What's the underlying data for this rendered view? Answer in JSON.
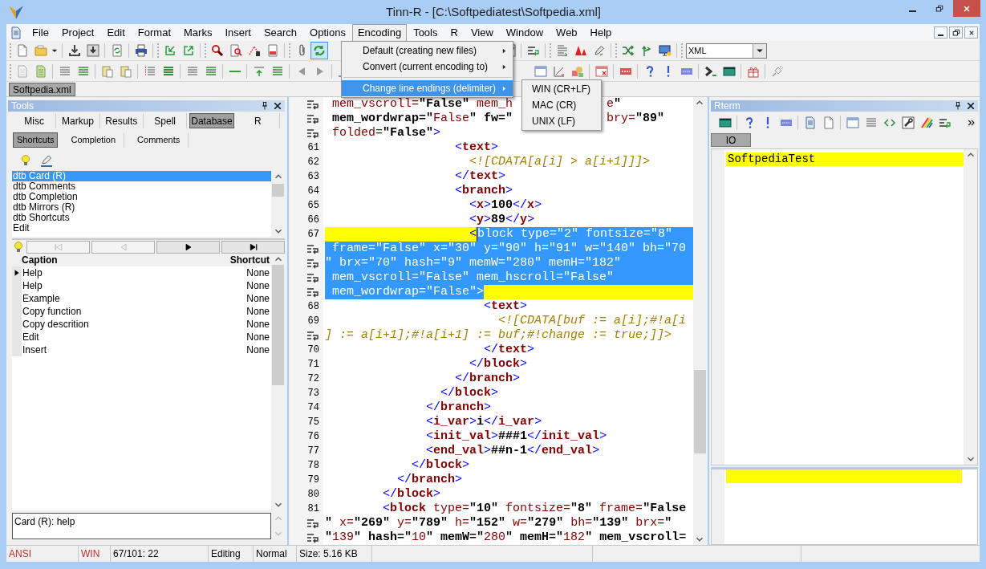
{
  "window": {
    "title": "Tinn-R - [C:\\Softpediatest\\Softpedia.xml]"
  },
  "menu_bar": [
    {
      "label": "File",
      "selected": false
    },
    {
      "label": "Project",
      "selected": false
    },
    {
      "label": "Edit",
      "selected": false
    },
    {
      "label": "Format",
      "selected": false
    },
    {
      "label": "Marks",
      "selected": false
    },
    {
      "label": "Insert",
      "selected": false
    },
    {
      "label": "Search",
      "selected": false
    },
    {
      "label": "Options",
      "selected": false
    },
    {
      "label": "Encoding",
      "selected": true
    },
    {
      "label": "Tools",
      "selected": false
    },
    {
      "label": "R",
      "selected": false
    },
    {
      "label": "View",
      "selected": false
    },
    {
      "label": "Window",
      "selected": false
    },
    {
      "label": "Web",
      "selected": false
    },
    {
      "label": "Help",
      "selected": false
    }
  ],
  "encoding_menu": {
    "items": [
      {
        "kind": "item",
        "label": "Default (creating new files)",
        "submenu": true,
        "selected": false
      },
      {
        "kind": "item",
        "label": "Convert (current encoding to)",
        "submenu": true,
        "selected": false
      },
      {
        "kind": "separator"
      },
      {
        "kind": "item",
        "label": "Change line endings (delimiter)",
        "submenu": true,
        "selected": true
      }
    ]
  },
  "line_endings_submenu": {
    "items": [
      {
        "label": "WIN (CR+LF)"
      },
      {
        "label": "MAC (CR)"
      },
      {
        "label": "UNIX (LF)"
      }
    ]
  },
  "language_selector": {
    "value": "XML"
  },
  "document_tabs": [
    {
      "label": "Softpedia.xml",
      "selected": true
    }
  ],
  "tools_panel": {
    "title": "Tools",
    "tabs": [
      {
        "label": "Misc",
        "selected": false
      },
      {
        "label": "Markup",
        "selected": false
      },
      {
        "label": "Results",
        "selected": false
      },
      {
        "label": "Spell",
        "selected": false
      },
      {
        "label": "Database",
        "selected": true
      },
      {
        "label": "R",
        "selected": false
      }
    ],
    "subtabs": [
      {
        "label": "Shortcuts",
        "selected": true
      },
      {
        "label": "Completion",
        "selected": false
      },
      {
        "label": "Comments",
        "selected": false
      }
    ],
    "list": [
      {
        "label": "dtb Card (R)",
        "selected": true
      },
      {
        "label": "dtb Comments",
        "selected": false
      },
      {
        "label": "dtb Completion",
        "selected": false
      },
      {
        "label": "dtb Mirrors (R)",
        "selected": false
      },
      {
        "label": "dtb Shortcuts",
        "selected": false
      },
      {
        "label": "Edit",
        "selected": false
      }
    ],
    "nav_buttons": [
      {
        "kind": "first",
        "disabled": true
      },
      {
        "kind": "prev",
        "disabled": true
      },
      {
        "kind": "next",
        "disabled": false
      },
      {
        "kind": "last",
        "disabled": false
      }
    ],
    "grid": {
      "columns": [
        "Caption",
        "Shortcut"
      ],
      "rows": [
        {
          "caption": "Help",
          "shortcut": "None",
          "current": true
        },
        {
          "caption": "Help",
          "shortcut": "None",
          "current": false
        },
        {
          "caption": "Example",
          "shortcut": "None",
          "current": false
        },
        {
          "caption": "Copy function",
          "shortcut": "None",
          "current": false
        },
        {
          "caption": "Copy descrition",
          "shortcut": "None",
          "current": false
        },
        {
          "caption": "Edit",
          "shortcut": "None",
          "current": false
        },
        {
          "caption": "Insert",
          "shortcut": "None",
          "current": false
        }
      ]
    },
    "memo": "Card (R): help"
  },
  "editor": {
    "rows": [
      {
        "kind": "wrap",
        "segments": [
          {
            "text": " mem_vscroll=\"False\" mem_h"
          },
          {
            "text": "e\""
          }
        ]
      },
      {
        "kind": "wrap",
        "segments": [
          {
            "text": " mem_wordwrap=\"False\" fw=\""
          },
          {
            "text": "bry=\"89\""
          }
        ]
      },
      {
        "kind": "wrap",
        "text": " folded=\"False\">"
      },
      {
        "kind": "line",
        "number": "61",
        "text": "                  <text>"
      },
      {
        "kind": "line",
        "number": "62",
        "text": "                    <![CDATA[a[i] > a[i+1]]]>",
        "cdata": true
      },
      {
        "kind": "line",
        "number": "63",
        "text": "                  </text>"
      },
      {
        "kind": "line",
        "number": "64",
        "text": "                  <branch>"
      },
      {
        "kind": "line",
        "number": "65",
        "text": "                    <x>100</x>"
      },
      {
        "kind": "line",
        "number": "66",
        "text": "                    <y>89</y>"
      },
      {
        "kind": "line",
        "number": "67",
        "text": "                    <",
        "current": true,
        "caret": true,
        "selection": {
          "text": "block type=\"2\" fontsize=\"8\"",
          "to_end": true
        }
      },
      {
        "kind": "wrap",
        "current": true,
        "selection": {
          "text": " frame=\"False\" x=\"30\" y=\"90\" h=\"91\" w=\"140\" bh=\"70",
          "to_end": true
        }
      },
      {
        "kind": "wrap",
        "current": true,
        "selection": {
          "text": "\" brx=\"70\" hash=\"9\" memW=\"280\" memH=\"182\"",
          "to_end": true
        }
      },
      {
        "kind": "wrap",
        "current": true,
        "selection": {
          "text": " mem_vscroll=\"False\" mem_hscroll=\"False\"",
          "to_end": true
        }
      },
      {
        "kind": "wrap",
        "current": true,
        "selection": {
          "text": " mem_wordwrap=\"False\">",
          "to_end": false
        }
      },
      {
        "kind": "line",
        "number": "68",
        "text": "                      <text>"
      },
      {
        "kind": "line",
        "number": "69",
        "text": "                        <![CDATA[buf := a[i];#!a[i",
        "cdata": true
      },
      {
        "kind": "wrap",
        "text": "] := a[i+1];#!a[i+1] := buf;#!change := true;]]>",
        "cdata": true
      },
      {
        "kind": "line",
        "number": "70",
        "text": "                      </text>"
      },
      {
        "kind": "line",
        "number": "71",
        "text": "                    </block>"
      },
      {
        "kind": "line",
        "number": "72",
        "text": "                  </branch>"
      },
      {
        "kind": "line",
        "number": "73",
        "text": "                </block>"
      },
      {
        "kind": "line",
        "number": "74",
        "text": "              </branch>"
      },
      {
        "kind": "line",
        "number": "75",
        "text": "              <i_var>i</i_var>"
      },
      {
        "kind": "line",
        "number": "76",
        "text": "              <init_val>###1</init_val>"
      },
      {
        "kind": "line",
        "number": "77",
        "text": "              <end_val>##n-1</end_val>"
      },
      {
        "kind": "line",
        "number": "78",
        "text": "            </block>"
      },
      {
        "kind": "line",
        "number": "79",
        "text": "          </branch>"
      },
      {
        "kind": "line",
        "number": "80",
        "text": "        </block>"
      },
      {
        "kind": "line",
        "number": "81",
        "text": "        <block type=\"10\" fontsize=\"8\" frame=\"False"
      },
      {
        "kind": "wrap",
        "text": "\" x=\"269\" y=\"789\" h=\"152\" w=\"279\" bh=\"139\" brx=\""
      },
      {
        "kind": "wrap",
        "text": "\"139\" hash=\"10\" memW=\"280\" memH=\"182\" mem_vscroll="
      }
    ]
  },
  "rterm": {
    "title": "Rterm",
    "tabs": [
      {
        "label": "IO",
        "selected": true
      }
    ],
    "console_line": "SoftpediaTest"
  },
  "status_bar": [
    {
      "text": "ANSI",
      "color": "#c0302a"
    },
    {
      "text": "WIN",
      "color": "#c0302a"
    },
    {
      "text": "67/101: 22",
      "color": "#000000"
    },
    {
      "text": "Editing",
      "color": "#000000"
    },
    {
      "text": "Normal",
      "color": "#000000"
    },
    {
      "text": "Size: 5.16 KB",
      "color": "#000000"
    }
  ]
}
